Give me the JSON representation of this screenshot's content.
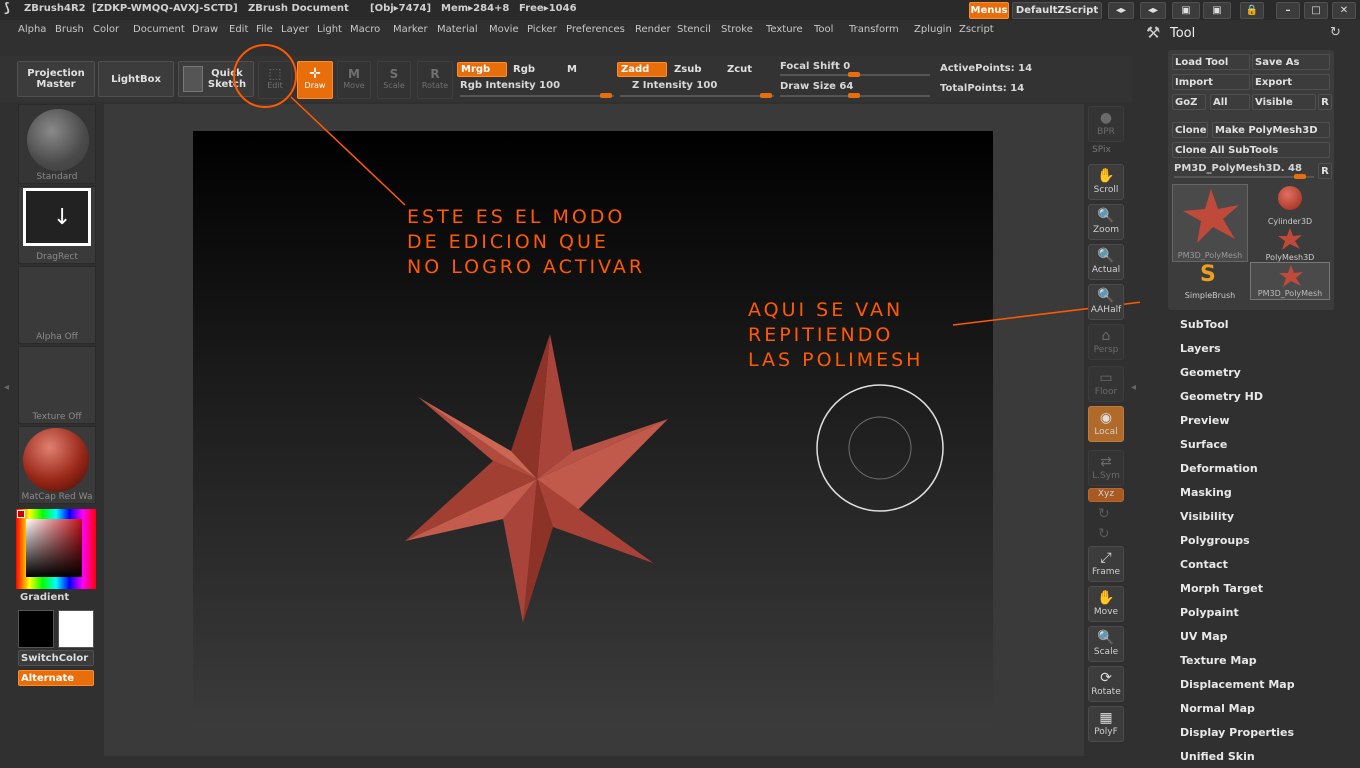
{
  "titlebar": {
    "app": "ZBrush4R2",
    "serial": "[ZDKP-WMQQ-AVXJ-SCTD]",
    "document": "ZBrush Document",
    "obj": "[Obj▸7474]",
    "mem": "Mem▸284+8",
    "free": "Free▸1046",
    "menus_button": "Menus",
    "default_script": "DefaultZScript"
  },
  "menubar": [
    "Alpha",
    "Brush",
    "Color",
    "Document",
    "Draw",
    "Edit",
    "File",
    "Layer",
    "Light",
    "Macro",
    "Marker",
    "Material",
    "Movie",
    "Picker",
    "Preferences",
    "Render",
    "Stencil",
    "Stroke",
    "Texture",
    "Tool",
    "Transform",
    "Zplugin",
    "Zscript"
  ],
  "toolbar": {
    "projection_master": "Projection Master",
    "lightbox": "LightBox",
    "quick_sketch": "Quick Sketch",
    "edit": "Edit",
    "draw": "Draw",
    "move": "Move",
    "scale": "Scale",
    "rotate": "Rotate",
    "mrgb": "Mrgb",
    "rgb": "Rgb",
    "m": "M",
    "zadd": "Zadd",
    "zsub": "Zsub",
    "zcut": "Zcut",
    "rgb_intensity": "Rgb Intensity 100",
    "z_intensity": "Z Intensity 100",
    "focal_shift": "Focal Shift 0",
    "draw_size": "Draw Size 64",
    "active_points": "ActivePoints: 14",
    "total_points": "TotalPoints: 14"
  },
  "leftshelf": {
    "brush": "Standard",
    "stroke": "DragRect",
    "alpha": "Alpha Off",
    "texture": "Texture Off",
    "material": "MatCap Red Wa",
    "gradient": "Gradient",
    "switch_color": "SwitchColor",
    "alternate": "Alternate"
  },
  "rightshelf": {
    "bpr": "BPR",
    "spix": "SPix",
    "scroll": "Scroll",
    "zoom": "Zoom",
    "actual": "Actual",
    "aahalf": "AAHalf",
    "persp": "Persp",
    "floor": "Floor",
    "local": "Local",
    "lsym": "L.Sym",
    "xyz": "Xyz",
    "frame": "Frame",
    "move": "Move",
    "scale": "Scale",
    "rotate": "Rotate",
    "polyf": "PolyF"
  },
  "toolpanel": {
    "title": "Tool",
    "load_tool": "Load Tool",
    "save_as": "Save As",
    "import": "Import",
    "export": "Export",
    "goz": "GoZ",
    "all": "All",
    "visible": "Visible",
    "r": "R",
    "clone": "Clone",
    "make_polymesh": "Make PolyMesh3D",
    "clone_all_subtools": "Clone All SubTools",
    "current_tool": "PM3D_PolyMesh3D. 48",
    "thumbs": {
      "main": "PM3D_PolyMesh",
      "cylinder": "Cylinder3D",
      "polymesh": "PolyMesh3D",
      "simplebrush": "SimpleBrush",
      "pm3d_copy": "PM3D_PolyMesh"
    },
    "sections": [
      "SubTool",
      "Layers",
      "Geometry",
      "Geometry HD",
      "Preview",
      "Surface",
      "Deformation",
      "Masking",
      "Visibility",
      "Polygroups",
      "Contact",
      "Morph Target",
      "Polypaint",
      "UV Map",
      "Texture Map",
      "Displacement Map",
      "Normal Map",
      "Display Properties",
      "Unified Skin"
    ]
  },
  "annotations": {
    "edit_mode": "ESTE ES EL MODO\nDE EDICION QUE\nNO LOGRO ACTIVAR",
    "polymesh": "AQUI SE VAN\nREPITIENDO\nLAS POLIMESH"
  },
  "colors": {
    "accent": "#e86e0c",
    "annotation": "#ff5a00",
    "star": "#b5483a"
  }
}
